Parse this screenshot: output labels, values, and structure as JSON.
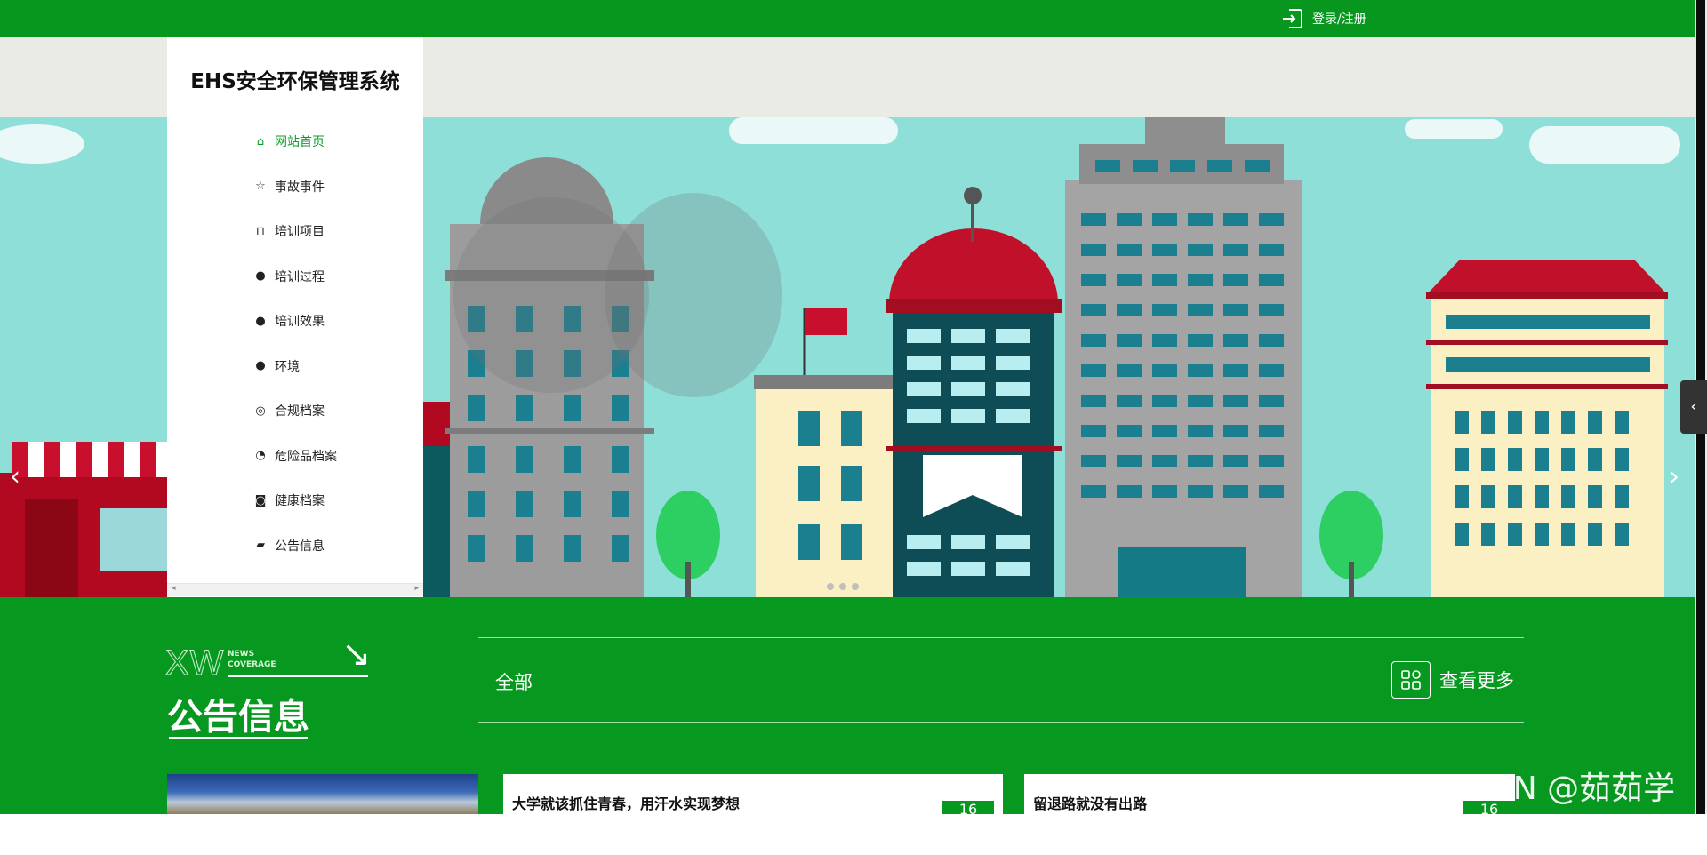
{
  "header": {
    "login_label": "登录/注册"
  },
  "sidebar": {
    "title": "EHS安全环保管理系统",
    "items": [
      {
        "label": "网站首页",
        "icon": "home-icon",
        "glyph": "⌂",
        "active": true
      },
      {
        "label": "事故事件",
        "icon": "star-icon",
        "glyph": "☆"
      },
      {
        "label": "培训项目",
        "icon": "bag-icon",
        "glyph": "⊓"
      },
      {
        "label": "培训过程",
        "icon": "alert-circle-icon",
        "glyph": "●"
      },
      {
        "label": "培训效果",
        "icon": "help-circle-icon",
        "glyph": "●"
      },
      {
        "label": "环境",
        "icon": "info-circle-icon",
        "glyph": "●"
      },
      {
        "label": "合规档案",
        "icon": "settings-circle-icon",
        "glyph": "◎"
      },
      {
        "label": "危险品档案",
        "icon": "gauge-icon",
        "glyph": "◔"
      },
      {
        "label": "健康档案",
        "icon": "camera-icon",
        "glyph": "◙"
      },
      {
        "label": "公告信息",
        "icon": "car-icon",
        "glyph": "▰"
      }
    ]
  },
  "banner": {
    "prev_icon": "‹",
    "next_icon": "›",
    "side_toggle": "‹"
  },
  "news": {
    "deco_letters": "XW",
    "deco_sub_1": "NEWS",
    "deco_sub_2": "COVERAGE",
    "title": "公告信息",
    "tab_all": "全部",
    "more_label": "查看更多",
    "cards": [
      {
        "title": "大学就该抓住青春，用汗水实现梦想",
        "date": "16"
      },
      {
        "title": "留退路就没有出路",
        "date": "16"
      }
    ]
  },
  "watermark": "CSDN @茹茹学姐",
  "colors": {
    "primary_green": "#07991f",
    "active_menu": "#0b9d2b"
  }
}
